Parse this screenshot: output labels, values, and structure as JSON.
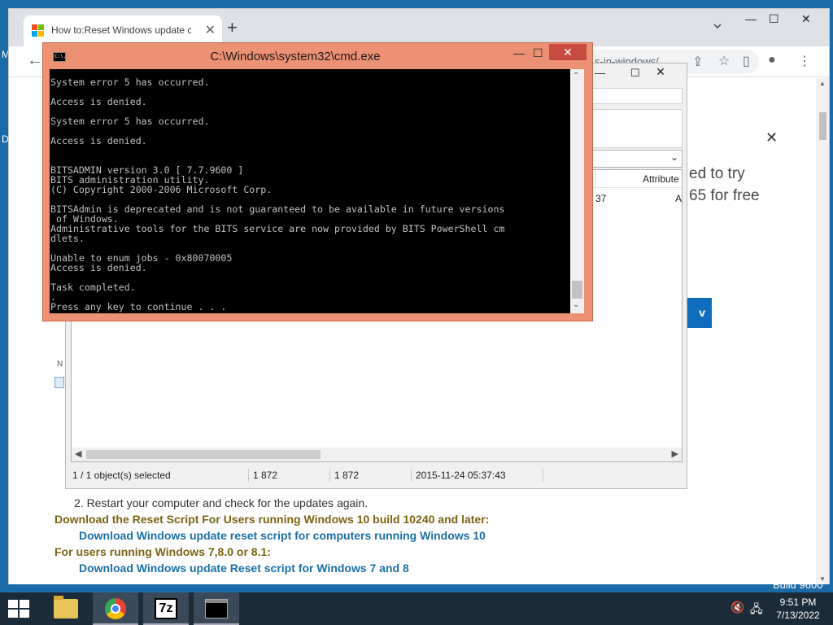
{
  "desktop": {
    "left_labels": [
      "M",
      "D"
    ],
    "build_text": "Build 9600"
  },
  "browser": {
    "tab_title": "How to:Reset Windows update c",
    "url_fragment": "s-in-windows/...",
    "win_controls": {
      "minimize": "—",
      "maximize": "☐",
      "close": "✕"
    },
    "page": {
      "promo_line1": "ed to try",
      "promo_line2": "65 for free",
      "promo_button": "v",
      "small_label": "N",
      "step": "2. Restart your computer and check for the updates again.",
      "heading1": "Download the Reset Script For Users running Windows 10 build 10240 and later:",
      "link1": "Download Windows update reset script for computers running Windows 10",
      "heading2": "For users running Windows 7,8.0 or 8.1:",
      "link2": "Download Windows update Reset script for Windows 7 and 8"
    }
  },
  "explorer": {
    "column_attr": "Attribute",
    "cell_left": "37",
    "cell_right": "A",
    "status": {
      "selected": "1 / 1 object(s) selected",
      "size": "1 872",
      "packed": "1 872",
      "modified": "2015-11-24 05:37:43"
    }
  },
  "cmd": {
    "title": "C:\\Windows\\system32\\cmd.exe",
    "icon_text": "C:\\.",
    "lines": [
      "System error 5 has occurred.",
      "",
      "Access is denied.",
      "",
      "System error 5 has occurred.",
      "",
      "Access is denied.",
      "",
      "",
      "BITSADMIN version 3.0 [ 7.7.9600 ]",
      "BITS administration utility.",
      "(C) Copyright 2000-2006 Microsoft Corp.",
      "",
      "BITSAdmin is deprecated and is not guaranteed to be available in future versions",
      " of Windows.",
      "Administrative tools for the BITS service are now provided by BITS PowerShell cm",
      "dlets.",
      "",
      "Unable to enum jobs - 0x80070005",
      "Access is denied.",
      "",
      "Task completed.",
      ".",
      "Press any key to continue . . ."
    ]
  },
  "taskbar": {
    "apps": [
      "file-explorer",
      "chrome",
      "7-zip",
      "command-prompt"
    ],
    "sevenzip_label": "7z",
    "clock_time": "9:51 PM",
    "clock_date": "7/13/2022"
  }
}
